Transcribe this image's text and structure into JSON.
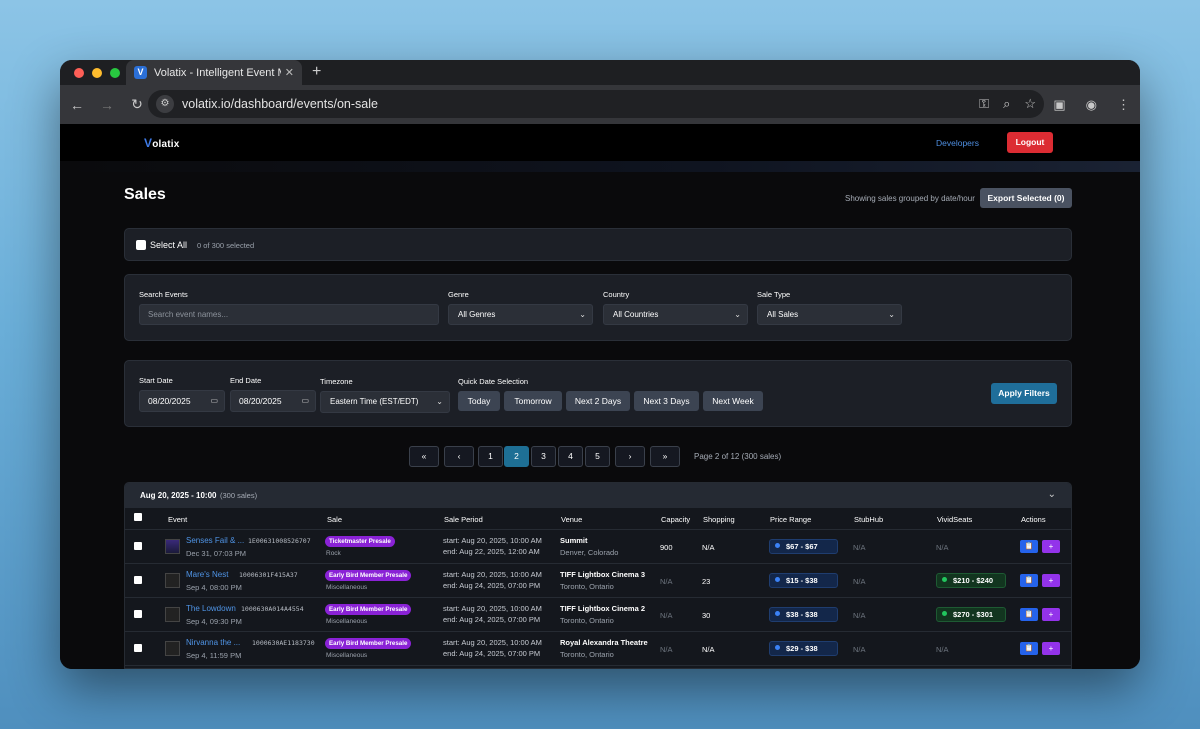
{
  "browser": {
    "tab_title": "Volatix - Intelligent Event Mon",
    "url": "volatix.io/dashboard/events/on-sale"
  },
  "nav": {
    "logo": "olatix",
    "logo_v": "V",
    "developers": "Developers",
    "logout": "Logout"
  },
  "header": {
    "title": "Sales",
    "grouping_note": "Showing sales grouped by date/hour",
    "export_label": "Export Selected (0)"
  },
  "selection": {
    "select_all": "Select All",
    "count": "0 of 300 selected"
  },
  "filters": {
    "search_label": "Search Events",
    "search_placeholder": "Search event names...",
    "genre_label": "Genre",
    "genre_value": "All Genres",
    "country_label": "Country",
    "country_value": "All Countries",
    "saletype_label": "Sale Type",
    "saletype_value": "All Sales"
  },
  "dates": {
    "start_label": "Start Date",
    "start_value": "08/20/2025",
    "end_label": "End Date",
    "end_value": "08/20/2025",
    "tz_label": "Timezone",
    "tz_value": "Eastern Time (EST/EDT)",
    "quick_label": "Quick Date Selection",
    "quick": [
      "Today",
      "Tomorrow",
      "Next 2 Days",
      "Next 3 Days",
      "Next Week"
    ],
    "apply": "Apply Filters"
  },
  "pagination": {
    "first": "«",
    "prev": "‹",
    "pages": [
      "1",
      "2",
      "3",
      "4",
      "5"
    ],
    "active_page": "2",
    "next": "›",
    "last": "»",
    "info": "Page 2 of 12 (300 sales)"
  },
  "group": {
    "date": "Aug 20, 2025 - 10:00",
    "count": "(300 sales)"
  },
  "columns": [
    "Event",
    "Sale",
    "Sale Period",
    "Venue",
    "Capacity",
    "Shopping",
    "Price Range",
    "StubHub",
    "VividSeats",
    "Actions"
  ],
  "rows": [
    {
      "name": "Senses Fail & ...",
      "id": "1E00631008526707",
      "date": "Dec 31, 07:03 PM",
      "sale": "Ticketmaster Presale",
      "genre": "Rock",
      "start": "start: Aug 20, 2025, 10:00 AM",
      "end": "end: Aug 22, 2025, 12:00 AM",
      "venue": "Summit",
      "city": "Denver, Colorado",
      "capacity": "900",
      "shopping": "N/A",
      "price": "$67 - $67",
      "stubhub": "N/A",
      "vivid": "N/A",
      "act1": "📋",
      "act2": "+"
    },
    {
      "name": "Mare's Nest",
      "id": "10006301F415A37",
      "date": "Sep 4, 08:00 PM",
      "sale": "Early Bird Member Presale",
      "genre": "Miscellaneous",
      "start": "start: Aug 20, 2025, 10:00 AM",
      "end": "end: Aug 24, 2025, 07:00 PM",
      "venue": "TIFF Lightbox Cinema 3",
      "city": "Toronto, Ontario",
      "capacity": "N/A",
      "shopping": "23",
      "price": "$15 - $38",
      "stubhub": "N/A",
      "vivid": "$210 - $240",
      "act1": "📋",
      "act2": "+"
    },
    {
      "name": "The Lowdown",
      "id": "1000630A014A4554",
      "date": "Sep 4, 09:30 PM",
      "sale": "Early Bird Member Presale",
      "genre": "Miscellaneous",
      "start": "start: Aug 20, 2025, 10:00 AM",
      "end": "end: Aug 24, 2025, 07:00 PM",
      "venue": "TIFF Lightbox Cinema 2",
      "city": "Toronto, Ontario",
      "capacity": "N/A",
      "shopping": "30",
      "price": "$38 - $38",
      "stubhub": "N/A",
      "vivid": "$270 - $301",
      "act1": "📋",
      "act2": "+"
    },
    {
      "name": "Nirvanna the ...",
      "id": "1000630AE1183730",
      "date": "Sep 4, 11:59 PM",
      "sale": "Early Bird Member Presale",
      "genre": "Miscellaneous",
      "start": "start: Aug 20, 2025, 10:00 AM",
      "end": "end: Aug 24, 2025, 07:00 PM",
      "venue": "Royal Alexandra Theatre",
      "city": "Toronto, Ontario",
      "capacity": "N/A",
      "shopping": "N/A",
      "price": "$29 - $38",
      "stubhub": "N/A",
      "vivid": "N/A",
      "act1": "📋",
      "act2": "+"
    }
  ]
}
